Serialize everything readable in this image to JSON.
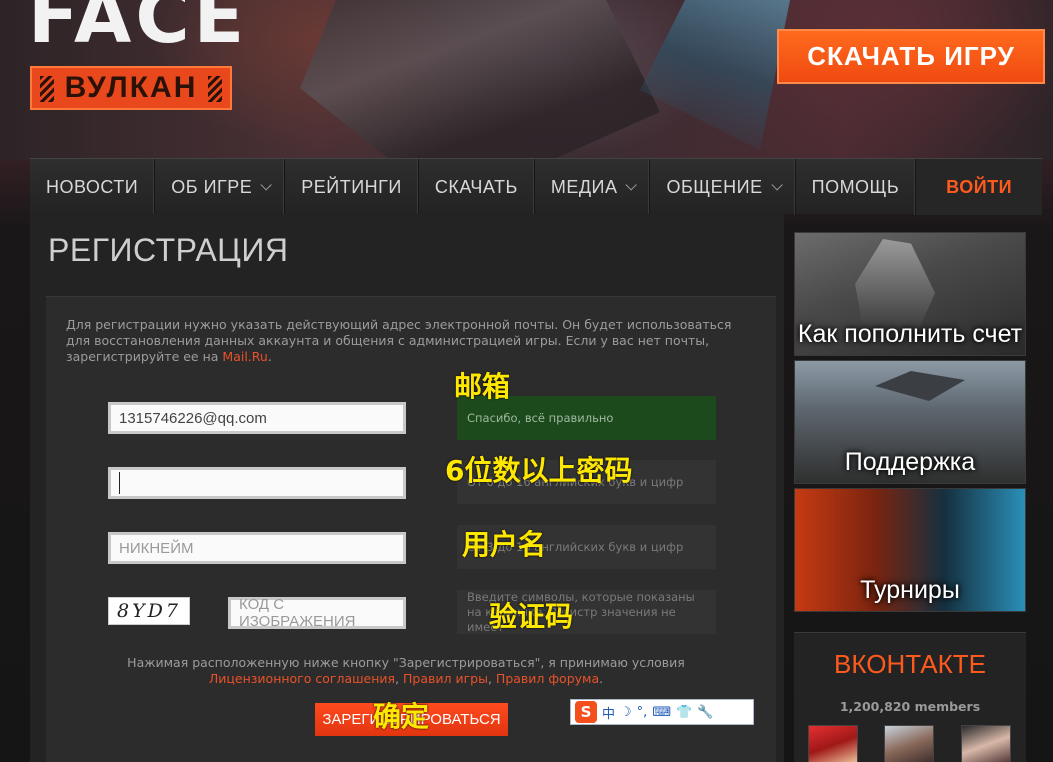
{
  "header": {
    "logo_top": "FACE",
    "logo_bottom": "ВУЛКАН",
    "download_label": "СКАЧАТЬ ИГРУ"
  },
  "nav": {
    "items": [
      {
        "label": "НОВОСТИ"
      },
      {
        "label": "ОБ ИГРЕ"
      },
      {
        "label": "РЕЙТИНГИ"
      },
      {
        "label": "СКАЧАТЬ"
      },
      {
        "label": "МЕДИА"
      },
      {
        "label": "ОБЩЕНИЕ"
      },
      {
        "label": "ПОМОЩЬ"
      }
    ],
    "login_label": "ВОЙТИ"
  },
  "page": {
    "title": "РЕГИСТРАЦИЯ",
    "intro_text": "Для регистрации нужно указать действующий адрес электронной почты. Он будет использоваться для восстановления данных аккаунта и общения с администрацией игры. Если у вас нет почты, зарегистрируйте ее на ",
    "intro_link": "Mail.Ru",
    "intro_end": "."
  },
  "form": {
    "email_value": "1315746226@qq.com",
    "email_hint": "Спасибо, всё правильно",
    "password_hint": "От 6 до 16 английских букв и цифр",
    "nickname_placeholder": "НИКНЕЙМ",
    "nickname_hint": "От 3 до 16 английских букв и цифр",
    "captcha_text": "8YD7",
    "captcha_placeholder": "КОД С ИЗОБРАЖЕНИЯ",
    "captcha_hint": "Введите символы, которые показаны на картинке. Регистр значения не имеет",
    "terms_text": "Нажимая расположенную ниже кнопку \"Зарегистрироваться\", я принимаю условия",
    "terms_link1": "Лицензионного соглашения",
    "terms_sep1": ", ",
    "terms_link2": "Правил игры",
    "terms_sep2": ", ",
    "terms_link3": "Правил форума",
    "terms_end": ".",
    "submit_label": "ЗАРЕГИСТРИРОВАТЬСЯ"
  },
  "annotations": {
    "email": "邮箱",
    "password": "6位数以上密码",
    "username": "用户名",
    "captcha": "验证码",
    "confirm": "确定"
  },
  "ime": {
    "logo": "S",
    "glyph1": "中",
    "glyph2": "☽",
    "glyph3": "°,",
    "glyph4": "⌨",
    "glyph5": "👕",
    "glyph6": "🔧"
  },
  "sidebar": {
    "cards": [
      {
        "label": "Как пополнить счет"
      },
      {
        "label": "Поддержка"
      },
      {
        "label": "Турниры"
      }
    ],
    "vk_title": "ВКОНТАКТЕ",
    "vk_members": "1,200,820 members"
  },
  "colors": {
    "accent": "#ff5a1e",
    "success_hint_bg": "#1d4a1d",
    "annotation": "#ffe800"
  }
}
